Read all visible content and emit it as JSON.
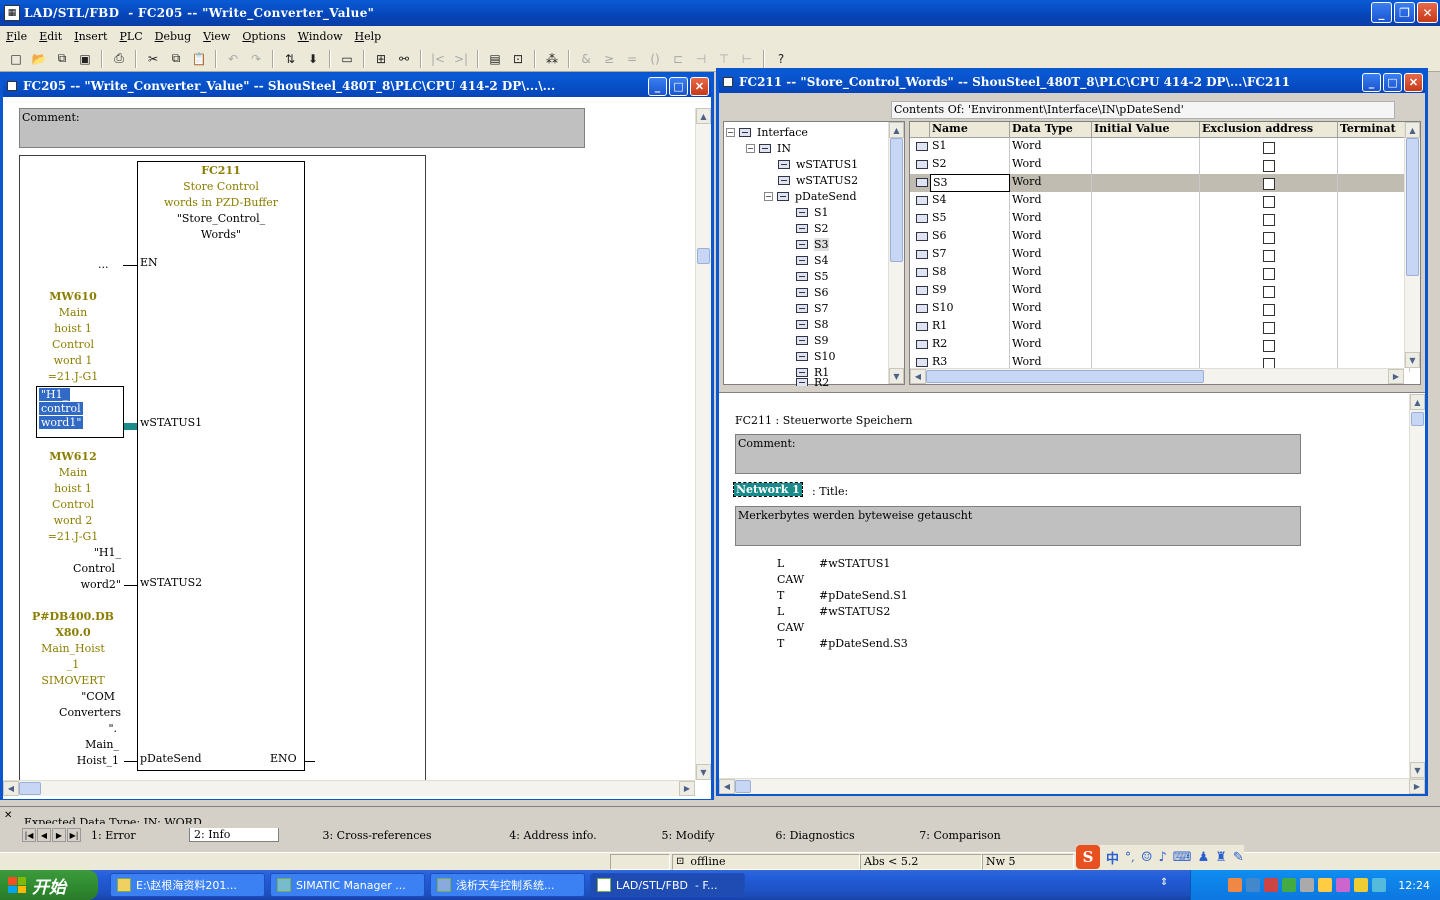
{
  "app": {
    "title": "LAD/STL/FBD  - FC205 -- \"Write_Converter_Value\""
  },
  "menu": [
    "File",
    "Edit",
    "Insert",
    "PLC",
    "Debug",
    "View",
    "Options",
    "Window",
    "Help"
  ],
  "left_window": {
    "title": "FC205 -- \"Write_Converter_Value\" -- ShouSteel_480T_8\\PLC\\CPU 414-2 DP\\...\\...",
    "comment_label": "Comment:",
    "block": {
      "name": "FC211",
      "desc1": "Store Control",
      "desc2": "words in PZD-Buffer",
      "symbol1": "\"Store_Control_",
      "symbol2": "Words\"",
      "pin_en": "EN",
      "pin_w1": "wSTATUS1",
      "pin_w2": "wSTATUS2",
      "pin_p": "pDateSend",
      "pin_eno": "ENO"
    },
    "en_input": "...",
    "inputs": {
      "a_addr": "MW610",
      "a_l1": "Main",
      "a_l2": "hoist 1",
      "a_l3": "Control",
      "a_l4": "word 1",
      "a_l5": "=21.J-G1",
      "a_sym1": "\"H1_",
      "a_sym2": "control",
      "a_sym3": "word1\"",
      "b_addr": "MW612",
      "b_l1": "Main",
      "b_l2": "hoist 1",
      "b_l3": "Control",
      "b_l4": "word 2",
      "b_l5": "=21.J-G1",
      "b_sym1": "\"H1_",
      "b_sym2": "Control",
      "b_sym3": "word2\"",
      "c_addr1": "P#DB400.DB",
      "c_addr2": "X80.0",
      "c_l1": "Main_Hoist",
      "c_l2": "_1",
      "c_l3": "SIMOVERT",
      "c_sym1": "\"COM",
      "c_sym2": "Converters",
      "c_sym3": "\".",
      "c_sym4": "Main_",
      "c_sym5": "Hoist_1"
    }
  },
  "right_window": {
    "title": "FC211 -- \"Store_Control_Words\" -- ShouSteel_480T_8\\PLC\\CPU 414-2 DP\\...\\FC211",
    "contents_of": "Contents Of: 'Environment\\Interface\\IN\\pDateSend'",
    "tree": {
      "root": "Interface",
      "in": "IN",
      "items": [
        "wSTATUS1",
        "wSTATUS2",
        "pDateSend"
      ],
      "sub": [
        "S1",
        "S2",
        "S3",
        "S4",
        "S5",
        "S6",
        "S7",
        "S8",
        "S9",
        "S10",
        "R1",
        "R2"
      ]
    },
    "table": {
      "columns": [
        "Name",
        "Data Type",
        "Initial Value",
        "Exclusion address",
        "Terminat"
      ],
      "rows": [
        {
          "name": "S1",
          "type": "Word"
        },
        {
          "name": "S2",
          "type": "Word"
        },
        {
          "name": "S3",
          "type": "Word"
        },
        {
          "name": "S4",
          "type": "Word"
        },
        {
          "name": "S5",
          "type": "Word"
        },
        {
          "name": "S6",
          "type": "Word"
        },
        {
          "name": "S7",
          "type": "Word"
        },
        {
          "name": "S8",
          "type": "Word"
        },
        {
          "name": "S9",
          "type": "Word"
        },
        {
          "name": "S10",
          "type": "Word"
        },
        {
          "name": "R1",
          "type": "Word"
        },
        {
          "name": "R2",
          "type": "Word"
        },
        {
          "name": "R3",
          "type": "Word"
        }
      ],
      "selected_row": "S3"
    },
    "code": {
      "header": "FC211 : Steuerworte Speichern",
      "comment_label": "Comment:",
      "network": "Network 1",
      "network_title": ": Title:",
      "network_comment": "Merkerbytes werden byteweise getauscht",
      "lines": [
        {
          "op": "L",
          "arg": "#wSTATUS1"
        },
        {
          "op": "CAW",
          "arg": ""
        },
        {
          "op": "T",
          "arg": "#pDateSend.S1"
        },
        {
          "op": "L",
          "arg": "#wSTATUS2"
        },
        {
          "op": "CAW",
          "arg": ""
        },
        {
          "op": "T",
          "arg": "#pDateSend.S3"
        }
      ]
    }
  },
  "output": {
    "message": "Expected Data Type: IN: WORD",
    "tabs": [
      "1: Error",
      "2: Info",
      "3: Cross-references",
      "4: Address info.",
      "5: Modify",
      "6: Diagnostics",
      "7: Comparison"
    ]
  },
  "status": {
    "mode": "offline",
    "abs": "Abs < 5.2",
    "nw": "Nw 5"
  },
  "taskbar": {
    "start": "开始",
    "tasks": [
      "E:\\赵根海资料201...",
      "SIMATIC Manager ...",
      "浅析天车控制系统...",
      "LAD/STL/FBD  - F..."
    ],
    "clock": "12:24"
  }
}
